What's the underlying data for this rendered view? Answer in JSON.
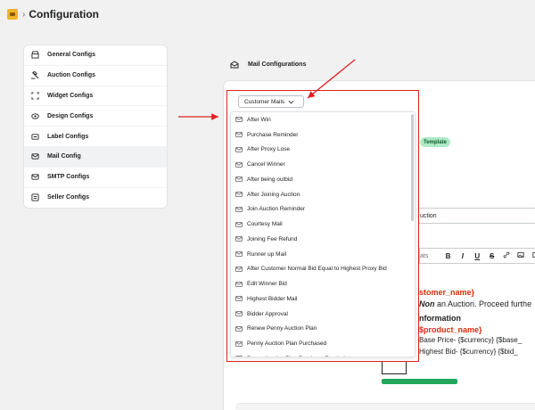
{
  "header": {
    "title": "Configuration",
    "separator": "›"
  },
  "sidebar": {
    "items": [
      {
        "label": "General Configs"
      },
      {
        "label": "Auction Configs"
      },
      {
        "label": "Widget Configs"
      },
      {
        "label": "Design Configs"
      },
      {
        "label": "Label Configs"
      },
      {
        "label": "Mail Config"
      },
      {
        "label": "SMTP Configs"
      },
      {
        "label": "Seller Configs"
      }
    ],
    "active_index": 5
  },
  "section": {
    "title": "Mail Configurations"
  },
  "dropdown": {
    "selected": "Customer Mails",
    "options": [
      "After Win",
      "Purchase Reminder",
      "After Proxy Lose",
      "Cancel Winner",
      "After being outbid",
      "After Joining Auction",
      "Join Auction Reminder",
      "Courtesy Mail",
      "Joining Fee Refund",
      "Runner up Mail",
      "After Customer Normal Bid Equal to Highest Proxy Bid",
      "Edit Winner Bid",
      "Highest Bidder Mail",
      "Bidder Approval",
      "Renew Penny Auction Plan",
      "Penny Auction Plan Purchased",
      "Penny Auction Plan Purchase Reminder"
    ]
  },
  "background": {
    "template_badge": "Template",
    "subject_value": "uction",
    "toolbar": {
      "formats": "ats",
      "bold": "B",
      "italic": "I",
      "underline": "U",
      "strike": "S"
    },
    "editor": {
      "line1": "stomer_name}",
      "line2_bold": "Non",
      "line2_rest": " an Auction. Proceed furthe",
      "line3": "nformation",
      "line4": "$product_name}",
      "line5": "Base Price- {$currency} {$base_",
      "line6": "Highest Bid- {$currency} {$bid_"
    }
  },
  "colors": {
    "annotation_red": "#e02020",
    "badge_green": "#aee9c5",
    "button_green": "#23a55a",
    "variable_red": "#d82c0d"
  }
}
